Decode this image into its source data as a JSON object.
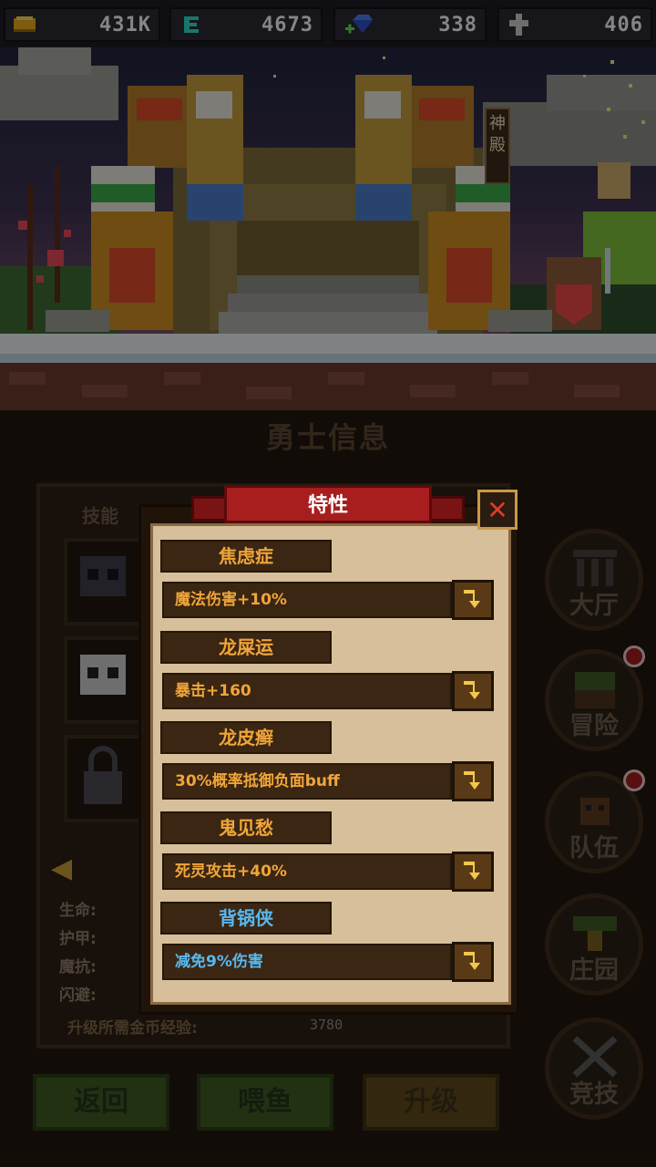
{
  "resources": [
    {
      "name": "gold",
      "icon": "gold-ingot-icon",
      "value": "431K"
    },
    {
      "name": "energy",
      "icon": "energy-rune-icon",
      "value": "4673"
    },
    {
      "name": "gems",
      "icon": "blue-gem-icon",
      "value": "338"
    },
    {
      "name": "crosses",
      "icon": "cross-icon",
      "value": "406"
    }
  ],
  "scene": {
    "temple_sign": "神殿"
  },
  "hero_panel": {
    "title": "勇士信息",
    "skills_label": "技能",
    "stats": [
      "生命:",
      "护甲:",
      "魔抗:",
      "闪避:"
    ],
    "upgrade_cost_label": "升级所需金币经验:",
    "upgrade_cost_value": "3780"
  },
  "bottom_buttons": {
    "back": "返回",
    "feed": "喂鱼",
    "upgrade": "升级"
  },
  "side_nav": [
    {
      "label": "大厅",
      "icon": "hall-icon",
      "badge": false
    },
    {
      "label": "冒险",
      "icon": "adventure-icon",
      "badge": true
    },
    {
      "label": "队伍",
      "icon": "team-icon",
      "badge": true
    },
    {
      "label": "庄园",
      "icon": "manor-icon",
      "badge": false
    },
    {
      "label": "竞技",
      "icon": "arena-swords-icon",
      "badge": false
    }
  ],
  "dialog": {
    "title": "特性",
    "traits": [
      {
        "name": "焦虑症",
        "effect": "魔法伤害+10%",
        "name_color": "orange",
        "effect_color": "orange"
      },
      {
        "name": "龙屎运",
        "effect": "暴击+160",
        "name_color": "orange",
        "effect_color": "orange"
      },
      {
        "name": "龙皮癣",
        "effect": "30%概率抵御负面buff",
        "name_color": "orange",
        "effect_color": "orange"
      },
      {
        "name": "鬼见愁",
        "effect": "死灵攻击+40%",
        "name_color": "orange",
        "effect_color": "orange"
      },
      {
        "name": "背锅侠",
        "effect": "减免9%伤害",
        "name_color": "blue",
        "effect_color": "blue"
      }
    ]
  },
  "colors": {
    "accent_red": "#a81d1d",
    "trait_orange": "#f0a53a",
    "trait_blue": "#58b8f0",
    "parchment": "#d6bf9a"
  }
}
